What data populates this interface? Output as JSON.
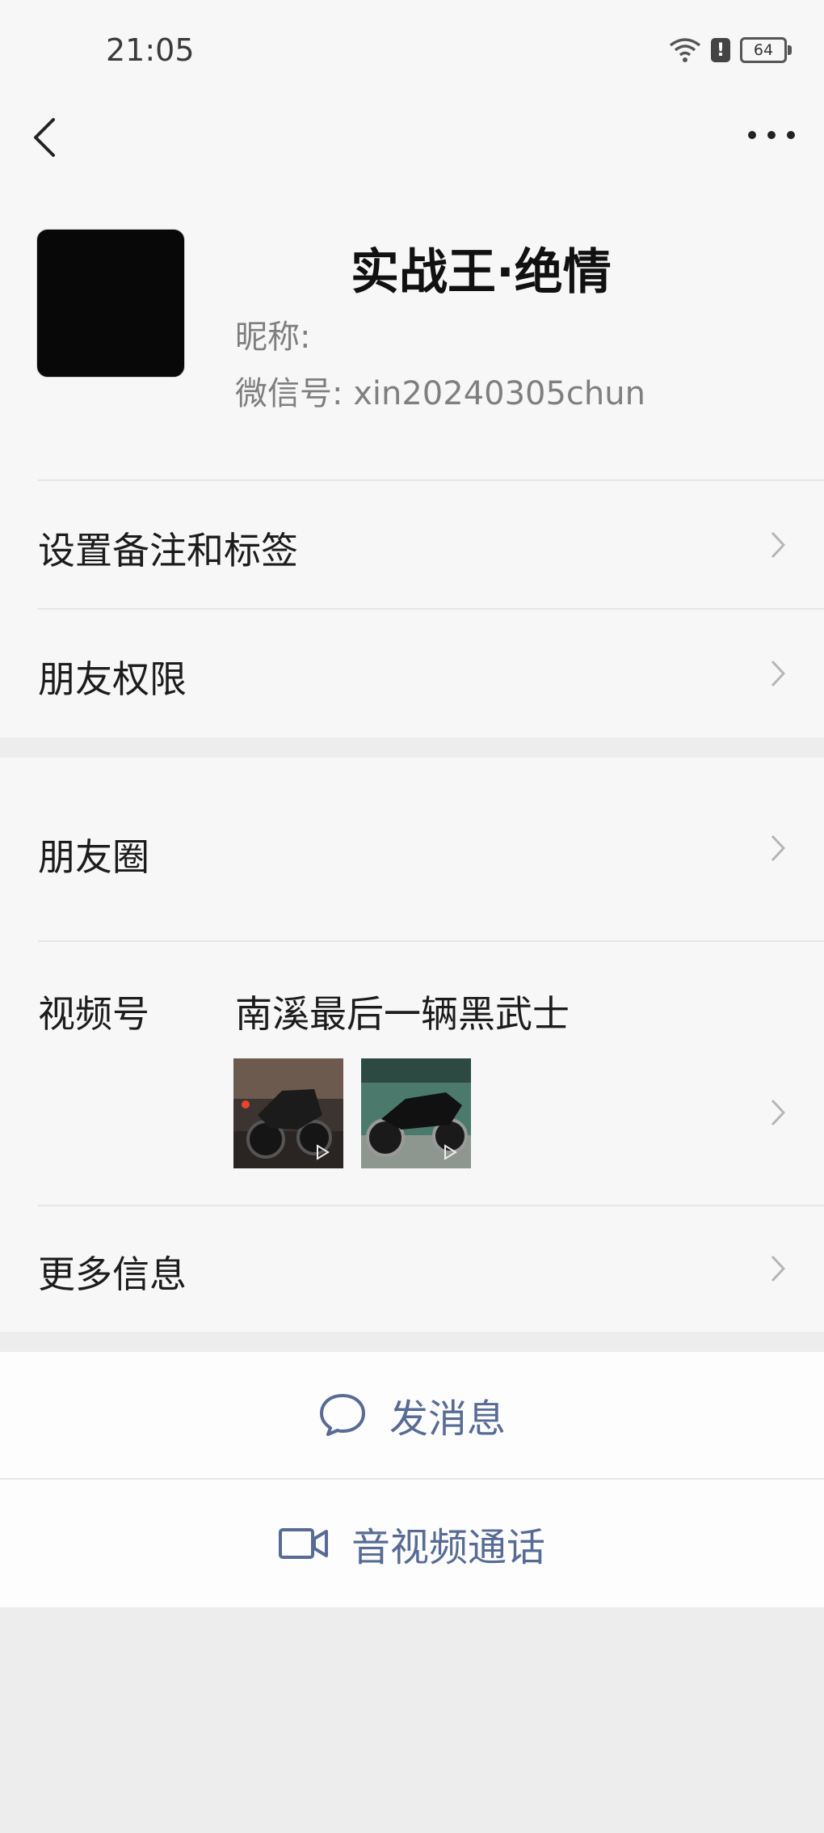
{
  "status": {
    "time": "21:05",
    "battery": "64"
  },
  "profile": {
    "title": "实战王·绝情",
    "nickname_label": "昵称:",
    "wechat_id_label": "微信号:",
    "wechat_id": "xin20240305chun"
  },
  "rows": {
    "remark": "设置备注和标签",
    "permissions": "朋友权限",
    "moments": "朋友圈",
    "channels_label": "视频号",
    "channels_name": "南溪最后一辆黑武士",
    "more_info": "更多信息"
  },
  "actions": {
    "message": "发消息",
    "call": "音视频通话"
  },
  "icons": {
    "back": "back-arrow-icon",
    "more": "more-dots-icon",
    "chevron": "chevron-right-icon",
    "chat": "chat-bubble-icon",
    "video": "video-camera-icon",
    "wifi": "wifi-icon",
    "alert": "alert-icon",
    "battery": "battery-icon"
  },
  "colors": {
    "action_text": "#576b95",
    "background": "#ededed",
    "panel": "#fdfdfd"
  }
}
